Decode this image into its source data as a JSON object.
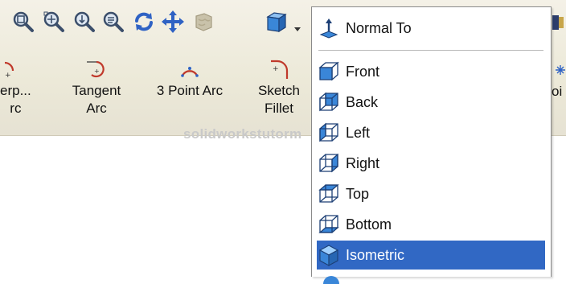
{
  "toolbar": {
    "view_icons": [
      "zoom-to-fit-icon",
      "zoom-to-area-icon",
      "zoom-in-out-icon",
      "zoom-to-selection-icon",
      "rotate-view-icon",
      "pan-icon",
      "shaded-display-icon",
      "view-orientation-icon"
    ],
    "sketch_tools": [
      {
        "label": "erp...\nrc",
        "icon": "perpendicular-arc-icon"
      },
      {
        "label": "Tangent\nArc",
        "icon": "tangent-arc-icon"
      },
      {
        "label": "3 Point Arc",
        "icon": "three-point-arc-icon"
      },
      {
        "label": "Sketch\nFillet",
        "icon": "sketch-fillet-icon"
      },
      {
        "label": "oi",
        "icon": "point-icon"
      }
    ]
  },
  "watermark": "solidworkstutorm",
  "view_menu": {
    "items": [
      {
        "label": "Normal To",
        "icon": "normal-to-icon",
        "selected": false
      },
      {
        "label": "Front",
        "icon": "front-view-icon",
        "selected": false
      },
      {
        "label": "Back",
        "icon": "back-view-icon",
        "selected": false
      },
      {
        "label": "Left",
        "icon": "left-view-icon",
        "selected": false
      },
      {
        "label": "Right",
        "icon": "right-view-icon",
        "selected": false
      },
      {
        "label": "Top",
        "icon": "top-view-icon",
        "selected": false
      },
      {
        "label": "Bottom",
        "icon": "bottom-view-icon",
        "selected": false
      },
      {
        "label": "Isometric",
        "icon": "isometric-view-icon",
        "selected": true
      }
    ]
  },
  "colors": {
    "toolbar_bg": "#ece9d8",
    "selection": "#3168c4",
    "cube_blue": "#3a86d8",
    "arc_red": "#c0392b"
  }
}
